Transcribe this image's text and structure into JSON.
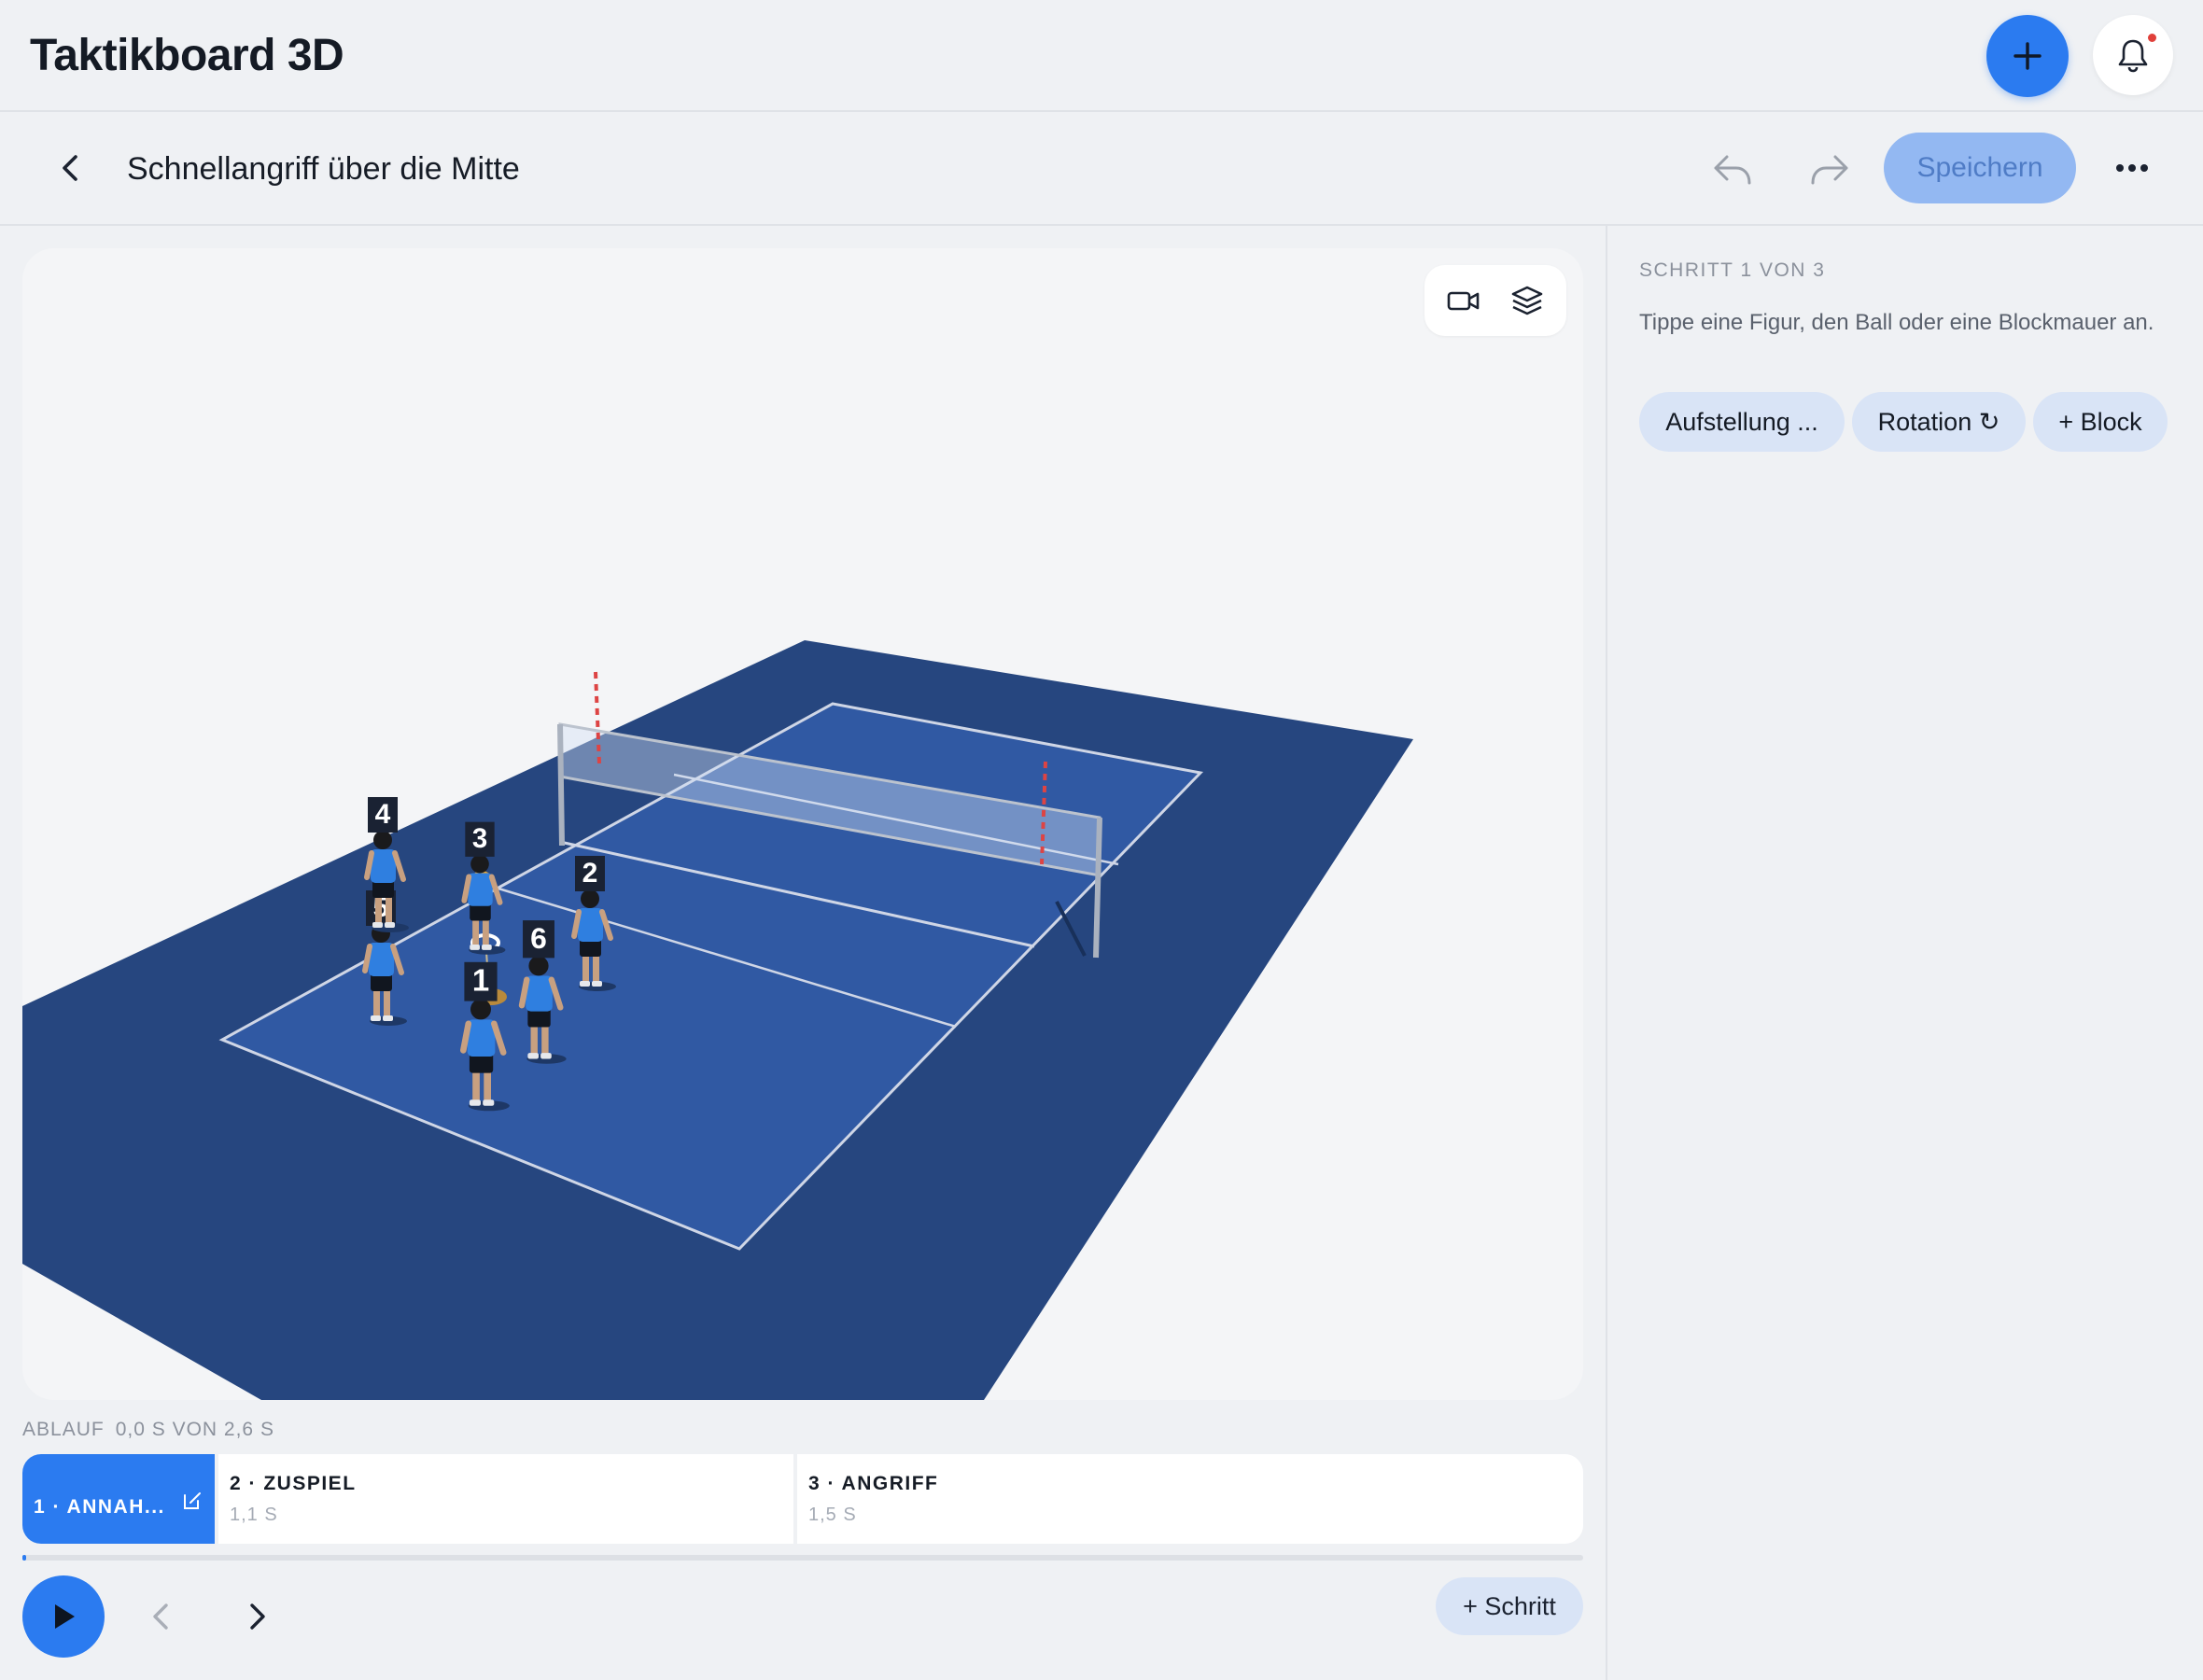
{
  "app": {
    "title": "Taktikboard 3D"
  },
  "header": {
    "add_icon": "plus-icon",
    "notifications_icon": "bell-icon",
    "accent": "#2b7bf0",
    "notification_dot_color": "#e0403a"
  },
  "document": {
    "title": "Schnellangriff über die Mitte",
    "save_label": "Speichern",
    "icons": [
      "chevron-left-icon",
      "undo-icon",
      "redo-icon",
      "more-horizontal-icon"
    ]
  },
  "viewport": {
    "tools": [
      "video-camera-icon",
      "layers-icon"
    ],
    "court_colors": {
      "floor": "#26467f",
      "court": "#3059a3",
      "lines": "#cfd6e6"
    },
    "player_labels": [
      "5",
      "4",
      "3",
      "2",
      "6",
      "1"
    ]
  },
  "timeline": {
    "label": "ABLAUF",
    "time": "0,0 S VON 2,6 S",
    "steps": [
      {
        "title": "1 · ANNAH...",
        "duration": ""
      },
      {
        "title": "2 · ZUSPIEL",
        "duration": "1,1 S"
      },
      {
        "title": "3 · ANGRIFF",
        "duration": "1,5 S"
      }
    ],
    "add_step_label": "+ Schritt",
    "progress_fraction": 0.0
  },
  "panel": {
    "step_counter": "SCHRITT 1 VON 3",
    "hint": "Tippe eine Figur, den Ball oder eine Blockmauer an.",
    "chips": [
      "Aufstellung ...",
      "Rotation ↻",
      "+ Block"
    ]
  }
}
